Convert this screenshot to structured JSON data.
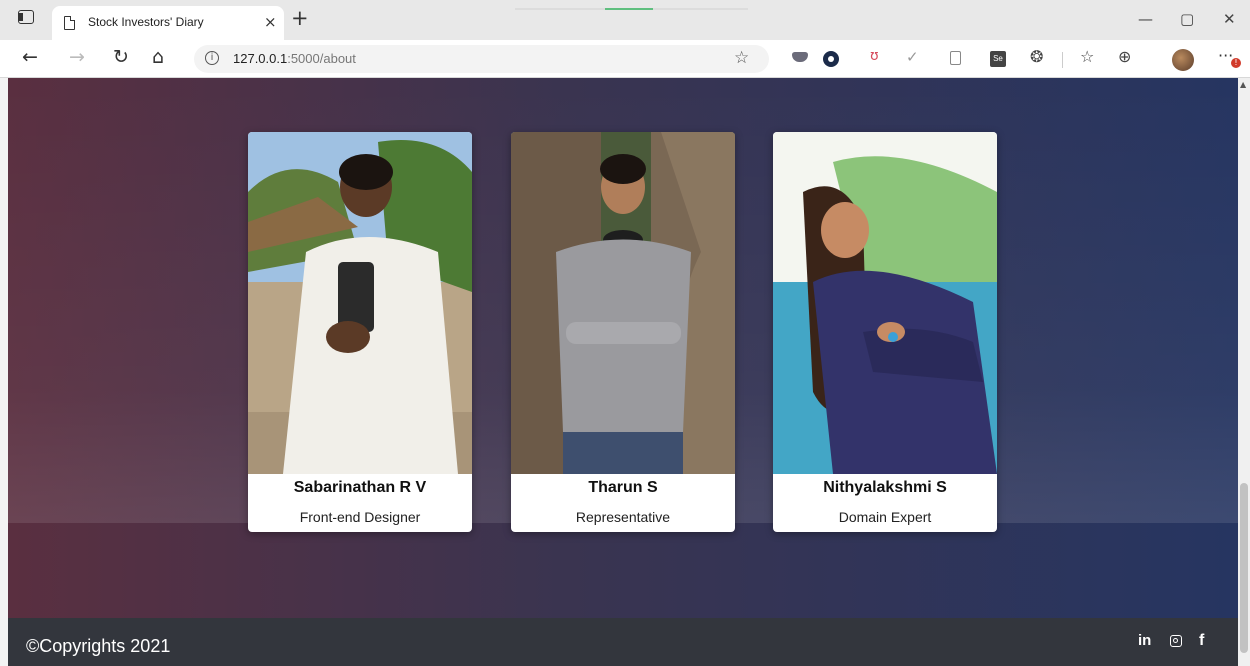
{
  "browser": {
    "tab_title": "Stock Investors' Diary",
    "tab_close": "×",
    "new_tab": "+",
    "url_host": "127.0.0.1",
    "url_path": ":5000/about",
    "window_controls": {
      "minimize": "—",
      "maximize": "▢",
      "close": "✕"
    },
    "nav": {
      "back": "←",
      "forward": "→",
      "refresh": "↻",
      "home": "⌂"
    },
    "info_glyph": "i",
    "more_glyph": "···",
    "notification_badge": "!"
  },
  "team": [
    {
      "name": "Sabarinathan R V",
      "role": "Front-end Designer",
      "photo_icon": "person-photo"
    },
    {
      "name": "Tharun S",
      "role": "Representative",
      "photo_icon": "person-photo"
    },
    {
      "name": "Nithyalakshmi S",
      "role": "Domain Expert",
      "photo_icon": "person-photo"
    }
  ],
  "footer": {
    "copyright": "©Copyrights 2021",
    "social": {
      "linkedin": "in",
      "instagram": "instagram-icon",
      "facebook": "f"
    }
  },
  "colors": {
    "page_gradient_start": "#5a2f40",
    "page_gradient_end": "#263561",
    "footer_bg": "#33363d",
    "card_bg": "#ffffff"
  }
}
